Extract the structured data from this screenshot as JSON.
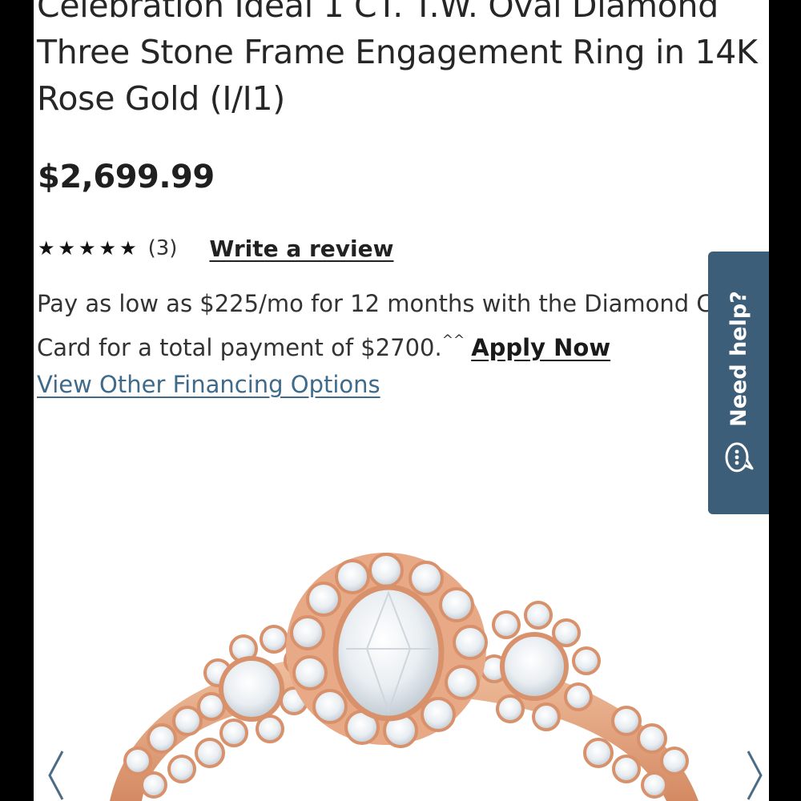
{
  "product": {
    "title": "Celebration Ideal 1 CT. T.W. Oval Diamond Three Stone Frame Engagement Ring in 14K Rose Gold (I/I1)",
    "price": "$2,699.99"
  },
  "rating": {
    "stars": "★★★★★",
    "count": "(3)",
    "write_review": "Write a review"
  },
  "financing": {
    "line1": "Pay as low as $225/mo for 12 months with the Diamond C",
    "line2": "Card for a total payment of $2700.",
    "footnote_mark": "^^",
    "apply_now": "Apply Now",
    "other_options": "View Other Financing Options"
  },
  "help_tab": {
    "label": "Need help?",
    "icon": "chat-bubble-icon"
  },
  "gallery": {
    "prev_icon": "chevron-left-icon",
    "next_icon": "chevron-right-icon",
    "image": "rose-gold-oval-three-stone-ring"
  },
  "colors": {
    "help_tab": "#3c5e78",
    "link_blue": "#3f6a8a",
    "rose_gold": "#e6a884"
  }
}
